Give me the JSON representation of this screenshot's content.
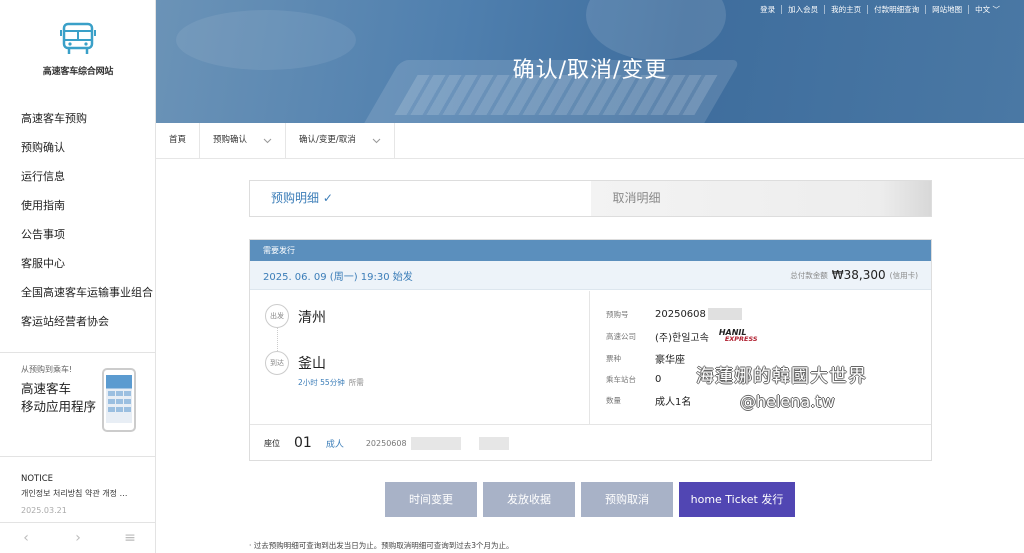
{
  "site": {
    "name": "高速客车综合网站"
  },
  "sidebar": {
    "items": [
      {
        "label": "高速客车预购"
      },
      {
        "label": "预购确认"
      },
      {
        "label": "运行信息"
      },
      {
        "label": "使用指南"
      },
      {
        "label": "公告事项"
      },
      {
        "label": "客服中心"
      },
      {
        "label": "全国高速客车运输事业组合"
      },
      {
        "label": "客运站经营者协会"
      }
    ],
    "promo": {
      "sub": "从预购到乘车!",
      "title1": "高速客车",
      "title2": "移动应用程序"
    },
    "notice": {
      "heading": "NOTICE",
      "title": "개인정보 처리방침 약관 개정 …",
      "date": "2025.03.21"
    },
    "notice_nav": {
      "prev": "‹",
      "next": "›",
      "menu": "≡"
    }
  },
  "util_links": [
    "登录",
    "加入会员",
    "我的主页",
    "付款明细查询",
    "网站地图",
    "中文"
  ],
  "hero": {
    "title": "确认/取消/变更"
  },
  "breadcrumb": {
    "home": "首頁",
    "level1": "预购确认",
    "level2": "确认/变更/取消"
  },
  "tabs": {
    "active": "预购明细",
    "active_mark": "✓",
    "inactive": "取消明细"
  },
  "reservation": {
    "header": "需要发行",
    "departure": "2025. 06. 09 (周一) 19:30 始发",
    "total_label": "总付款金额",
    "total_amount": "₩38,300",
    "payment_method": "(信用卡)",
    "depart_badge": "出发",
    "arrive_badge": "到达",
    "from": "清州",
    "to": "釜山",
    "duration": "2小时 55分钟",
    "duration_suffix": "所需",
    "details": [
      {
        "key": "预购号",
        "value": "20250608"
      },
      {
        "key": "高速公司",
        "value": "(주)한일고속"
      },
      {
        "key": "票种",
        "value": "豪华座"
      },
      {
        "key": "乘车站台",
        "value": "0"
      },
      {
        "key": "数量",
        "value": "成人1名"
      }
    ],
    "hanil_logo": {
      "top": "HANIL",
      "bottom": "EXPRESS"
    },
    "seat": {
      "label": "座位",
      "number": "01",
      "type": "成人",
      "ticket_no": "20250608"
    }
  },
  "buttons": {
    "change_time": "时间变更",
    "issue_receipt": "发放收据",
    "cancel": "预购取消",
    "home_ticket": "home Ticket 发行"
  },
  "footnote": "· 过去预购明细可查询到出发当日为止。预购取消明细可查询到过去3个月为止。",
  "watermark": {
    "line1": "海蓮娜的韓國大世界",
    "line2": "@helena.tw"
  },
  "colors": {
    "accent": "#3b7db8",
    "header_bar": "#5b8fbd",
    "primary_button": "#5146b3",
    "grey_button": "#a8b2c7"
  }
}
